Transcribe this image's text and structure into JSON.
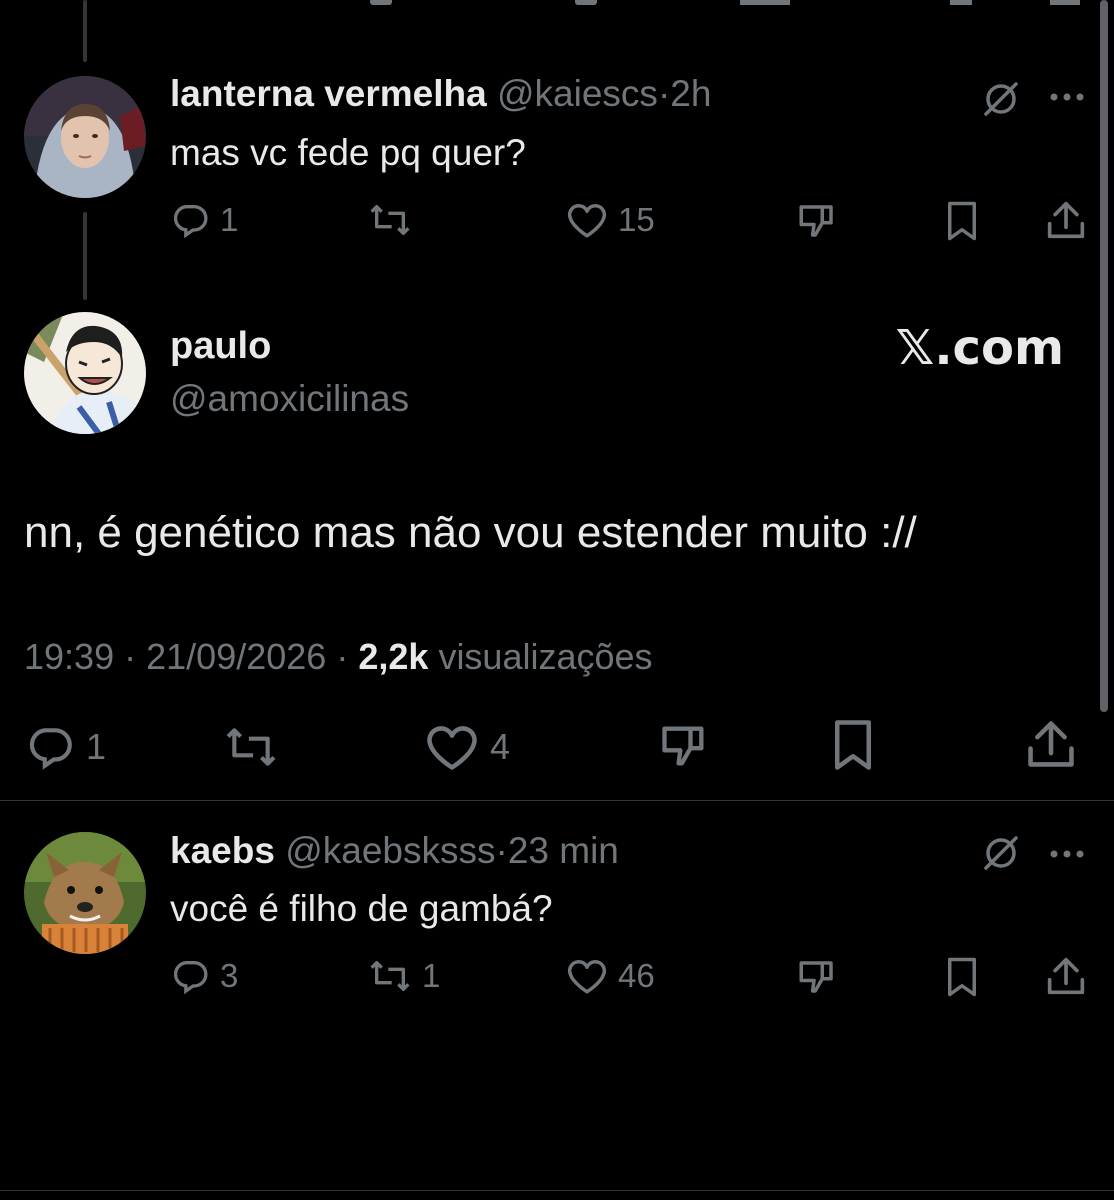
{
  "reply1": {
    "name": "lanterna vermelha",
    "handle": "@kaiescs",
    "time": "2h",
    "text": "mas vc fede pq quer?",
    "replies": "1",
    "reposts": "",
    "likes": "15"
  },
  "main": {
    "name": "paulo",
    "handle": "@amoxicilinas",
    "watermark": "𝕏.com",
    "text": "nn, é genético mas não vou estender muito ://",
    "time": "19:39",
    "date": "21/09/2026",
    "views_count": "2,2k",
    "views_label": "visualizações",
    "replies": "1",
    "reposts": "",
    "likes": "4"
  },
  "reply2": {
    "name": "kaebs",
    "handle": "@kaebsksss",
    "time": "23 min",
    "text": "você é filho de gambá?",
    "replies": "3",
    "reposts": "1",
    "likes": "46"
  },
  "separator": "·",
  "icons": [
    "reply-icon",
    "repost-icon",
    "like-icon",
    "downvote-icon",
    "bookmark-icon",
    "share-icon",
    "grok-icon",
    "more-icon"
  ]
}
